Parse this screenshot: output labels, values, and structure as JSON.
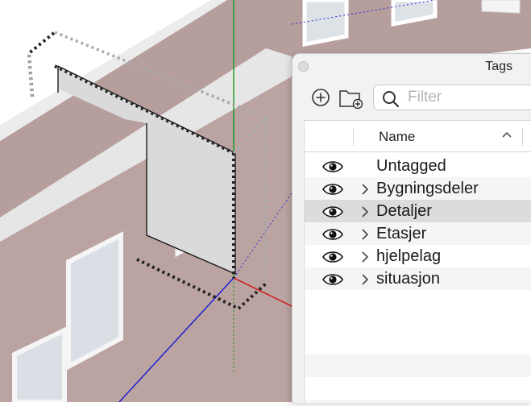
{
  "panel": {
    "title": "Tags",
    "search": {
      "placeholder": "Filter",
      "value": ""
    },
    "columns": {
      "name": "Name",
      "sort": "ascending"
    },
    "rows": [
      {
        "label": "Untagged",
        "visible": true,
        "expandable": false,
        "selected": false
      },
      {
        "label": "Bygningsdeler",
        "visible": true,
        "expandable": true,
        "selected": false
      },
      {
        "label": "Detaljer",
        "visible": true,
        "expandable": true,
        "selected": true
      },
      {
        "label": "Etasjer",
        "visible": true,
        "expandable": true,
        "selected": false
      },
      {
        "label": "hjelpelag",
        "visible": true,
        "expandable": true,
        "selected": false
      },
      {
        "label": "situasjon",
        "visible": true,
        "expandable": true,
        "selected": false
      }
    ]
  },
  "viewport": {
    "axis_colors": {
      "x": "#d01010",
      "y": "#1a9a1a",
      "z": "#1a1ad0"
    },
    "wall_color": "#b29a9a",
    "selection_color": "#222222",
    "highlight_color": "#999999"
  },
  "colors": {
    "row_selected": "#dcdcdc",
    "stripe": "#f5f5f5",
    "panel_bg": "#f2f2f2"
  }
}
